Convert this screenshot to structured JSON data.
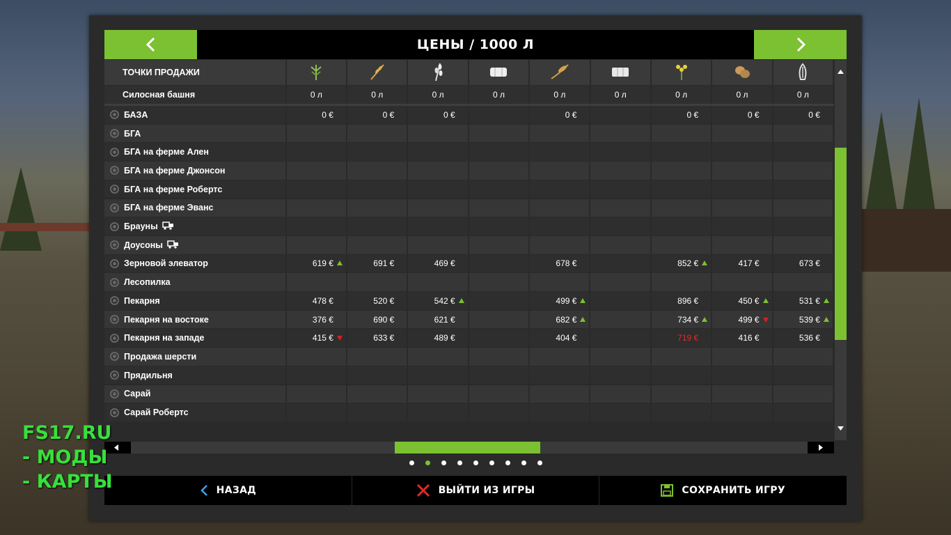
{
  "header": {
    "title": "ЦЕНЫ / 1000 Л"
  },
  "table": {
    "points_label": "ТОЧКИ ПРОДАЖИ",
    "product_icons": [
      "grass-icon",
      "wheat-icon",
      "barley-icon",
      "bale-icon",
      "rapeseed-icon",
      "bale-square-icon",
      "sunflower-icon",
      "potato-icon",
      "sugarbeet-icon"
    ],
    "silo": {
      "label": "Силосная башня",
      "values": [
        "0 л",
        "0 л",
        "0 л",
        "0 л",
        "0 л",
        "0 л",
        "0 л",
        "0 л",
        "0 л"
      ]
    },
    "rows": [
      {
        "name": "БАЗА",
        "train": false,
        "prices": [
          "0 €",
          "0 €",
          "0 €",
          "",
          "0 €",
          "",
          "0 €",
          "0 €",
          "0 €"
        ],
        "trend": [
          "",
          "",
          "",
          "",
          "",
          "",
          "",
          "",
          ""
        ],
        "red": []
      },
      {
        "name": "БГА",
        "train": false,
        "prices": [
          "",
          "",
          "",
          "",
          "",
          "",
          "",
          "",
          ""
        ],
        "trend": [
          "",
          "",
          "",
          "",
          "",
          "",
          "",
          "",
          ""
        ],
        "red": []
      },
      {
        "name": "БГА на ферме Ален",
        "train": false,
        "prices": [
          "",
          "",
          "",
          "",
          "",
          "",
          "",
          "",
          ""
        ],
        "trend": [
          "",
          "",
          "",
          "",
          "",
          "",
          "",
          "",
          ""
        ],
        "red": []
      },
      {
        "name": "БГА на ферме Джонсон",
        "train": false,
        "prices": [
          "",
          "",
          "",
          "",
          "",
          "",
          "",
          "",
          ""
        ],
        "trend": [
          "",
          "",
          "",
          "",
          "",
          "",
          "",
          "",
          ""
        ],
        "red": []
      },
      {
        "name": "БГА на ферме Робертс",
        "train": false,
        "prices": [
          "",
          "",
          "",
          "",
          "",
          "",
          "",
          "",
          ""
        ],
        "trend": [
          "",
          "",
          "",
          "",
          "",
          "",
          "",
          "",
          ""
        ],
        "red": []
      },
      {
        "name": "БГА на ферме Эванс",
        "train": false,
        "prices": [
          "",
          "",
          "",
          "",
          "",
          "",
          "",
          "",
          ""
        ],
        "trend": [
          "",
          "",
          "",
          "",
          "",
          "",
          "",
          "",
          ""
        ],
        "red": []
      },
      {
        "name": "Брауны",
        "train": true,
        "prices": [
          "",
          "",
          "",
          "",
          "",
          "",
          "",
          "",
          ""
        ],
        "trend": [
          "",
          "",
          "",
          "",
          "",
          "",
          "",
          "",
          ""
        ],
        "red": []
      },
      {
        "name": "Доусоны",
        "train": true,
        "prices": [
          "",
          "",
          "",
          "",
          "",
          "",
          "",
          "",
          ""
        ],
        "trend": [
          "",
          "",
          "",
          "",
          "",
          "",
          "",
          "",
          ""
        ],
        "red": []
      },
      {
        "name": "Зерновой элеватор",
        "train": false,
        "prices": [
          "619 €",
          "691 €",
          "469 €",
          "",
          "678 €",
          "",
          "852 €",
          "417 €",
          "673 €"
        ],
        "trend": [
          "up",
          "",
          "",
          "",
          "",
          "",
          "up",
          "",
          ""
        ],
        "red": []
      },
      {
        "name": "Лесопилка",
        "train": false,
        "prices": [
          "",
          "",
          "",
          "",
          "",
          "",
          "",
          "",
          ""
        ],
        "trend": [
          "",
          "",
          "",
          "",
          "",
          "",
          "",
          "",
          ""
        ],
        "red": []
      },
      {
        "name": "Пекарня",
        "train": false,
        "prices": [
          "478 €",
          "520 €",
          "542 €",
          "",
          "499 €",
          "",
          "896 €",
          "450 €",
          "531 €"
        ],
        "trend": [
          "",
          "",
          "up",
          "",
          "up",
          "",
          "",
          "up",
          "up"
        ],
        "red": []
      },
      {
        "name": "Пекарня на востоке",
        "train": false,
        "prices": [
          "376 €",
          "690 €",
          "621 €",
          "",
          "682 €",
          "",
          "734 €",
          "499 €",
          "539 €"
        ],
        "trend": [
          "",
          "",
          "",
          "",
          "up",
          "",
          "up",
          "down",
          "up"
        ],
        "red": []
      },
      {
        "name": "Пекарня на западе",
        "train": false,
        "prices": [
          "415 €",
          "633 €",
          "489 €",
          "",
          "404 €",
          "",
          "719 €",
          "416 €",
          "536 €"
        ],
        "trend": [
          "down",
          "",
          "",
          "",
          "",
          "",
          "",
          "",
          ""
        ],
        "red": [
          6
        ]
      },
      {
        "name": "Продажа шерсти",
        "train": false,
        "prices": [
          "",
          "",
          "",
          "",
          "",
          "",
          "",
          "",
          ""
        ],
        "trend": [
          "",
          "",
          "",
          "",
          "",
          "",
          "",
          "",
          ""
        ],
        "red": []
      },
      {
        "name": "Прядильня",
        "train": false,
        "prices": [
          "",
          "",
          "",
          "",
          "",
          "",
          "",
          "",
          ""
        ],
        "trend": [
          "",
          "",
          "",
          "",
          "",
          "",
          "",
          "",
          ""
        ],
        "red": []
      },
      {
        "name": "Сарай",
        "train": false,
        "prices": [
          "",
          "",
          "",
          "",
          "",
          "",
          "",
          "",
          ""
        ],
        "trend": [
          "",
          "",
          "",
          "",
          "",
          "",
          "",
          "",
          ""
        ],
        "red": []
      },
      {
        "name": "Сарай Робертс",
        "train": false,
        "prices": [
          "",
          "",
          "",
          "",
          "",
          "",
          "",
          "",
          ""
        ],
        "trend": [
          "",
          "",
          "",
          "",
          "",
          "",
          "",
          "",
          ""
        ],
        "red": []
      }
    ]
  },
  "pagination": {
    "pages": 9,
    "active": 1
  },
  "footer": {
    "back_label": "НАЗАД",
    "quit_label": "ВЫЙТИ ИЗ ИГРЫ",
    "save_label": "СОХРАНИТЬ ИГРУ"
  },
  "watermark": {
    "line1": "FS17.RU",
    "line2": "- МОДЫ",
    "line3": "- КАРТЫ"
  },
  "colors": {
    "accent": "#7cc132",
    "down": "#d62020",
    "panel": "#2a2a2a"
  }
}
